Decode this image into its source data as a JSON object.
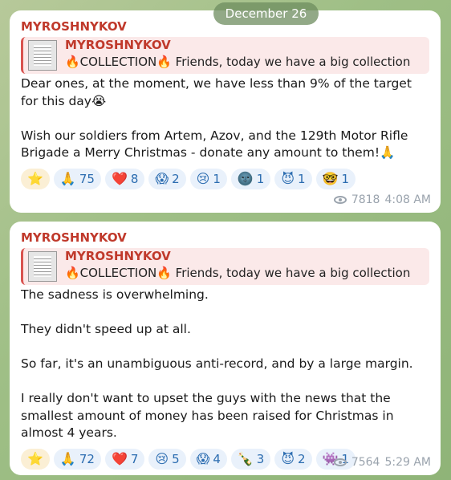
{
  "date_label": "December 26",
  "messages": [
    {
      "sender": "MYROSHNYKOV",
      "reply": {
        "name": "MYROSHNYKOV",
        "text": "🔥COLLECTION🔥  Friends, today we have a big collection"
      },
      "paragraphs": [
        "Dear ones, at the moment, we have less than 9% of the target for this day😭",
        "Wish our soldiers from Artem, Azov, and the 129th Motor Rifle Brigade a Merry Christmas - donate any amount to them!🙏"
      ],
      "reactions": [
        {
          "emoji": "⭐",
          "count": ""
        },
        {
          "emoji": "🙏",
          "count": "75"
        },
        {
          "emoji": "❤️",
          "count": "8"
        },
        {
          "emoji": "😱",
          "count": "2"
        },
        {
          "emoji": "😢",
          "count": "1"
        },
        {
          "emoji": "🌚",
          "count": "1"
        },
        {
          "emoji": "😈",
          "count": "1"
        },
        {
          "emoji": "🤓",
          "count": "1"
        }
      ],
      "views": "7818",
      "time": "4:08 AM"
    },
    {
      "sender": "MYROSHNYKOV",
      "reply": {
        "name": "MYROSHNYKOV",
        "text": "🔥COLLECTION🔥  Friends, today we have a big collection"
      },
      "paragraphs": [
        "The sadness is overwhelming.",
        "They didn't speed up at all.",
        "So far, it's an unambiguous anti-record, and by a large margin.",
        "I really don't want to upset the guys with the news that the smallest amount of money has been raised for Christmas in almost 4 years."
      ],
      "reactions": [
        {
          "emoji": "⭐",
          "count": ""
        },
        {
          "emoji": "🙏",
          "count": "72"
        },
        {
          "emoji": "❤️",
          "count": "7"
        },
        {
          "emoji": "😢",
          "count": "5"
        },
        {
          "emoji": "😱",
          "count": "4"
        },
        {
          "emoji": "🍾",
          "count": "3"
        },
        {
          "emoji": "😈",
          "count": "2"
        },
        {
          "emoji": "👾",
          "count": "1"
        }
      ],
      "views": "7564",
      "time": "5:29 AM"
    }
  ]
}
